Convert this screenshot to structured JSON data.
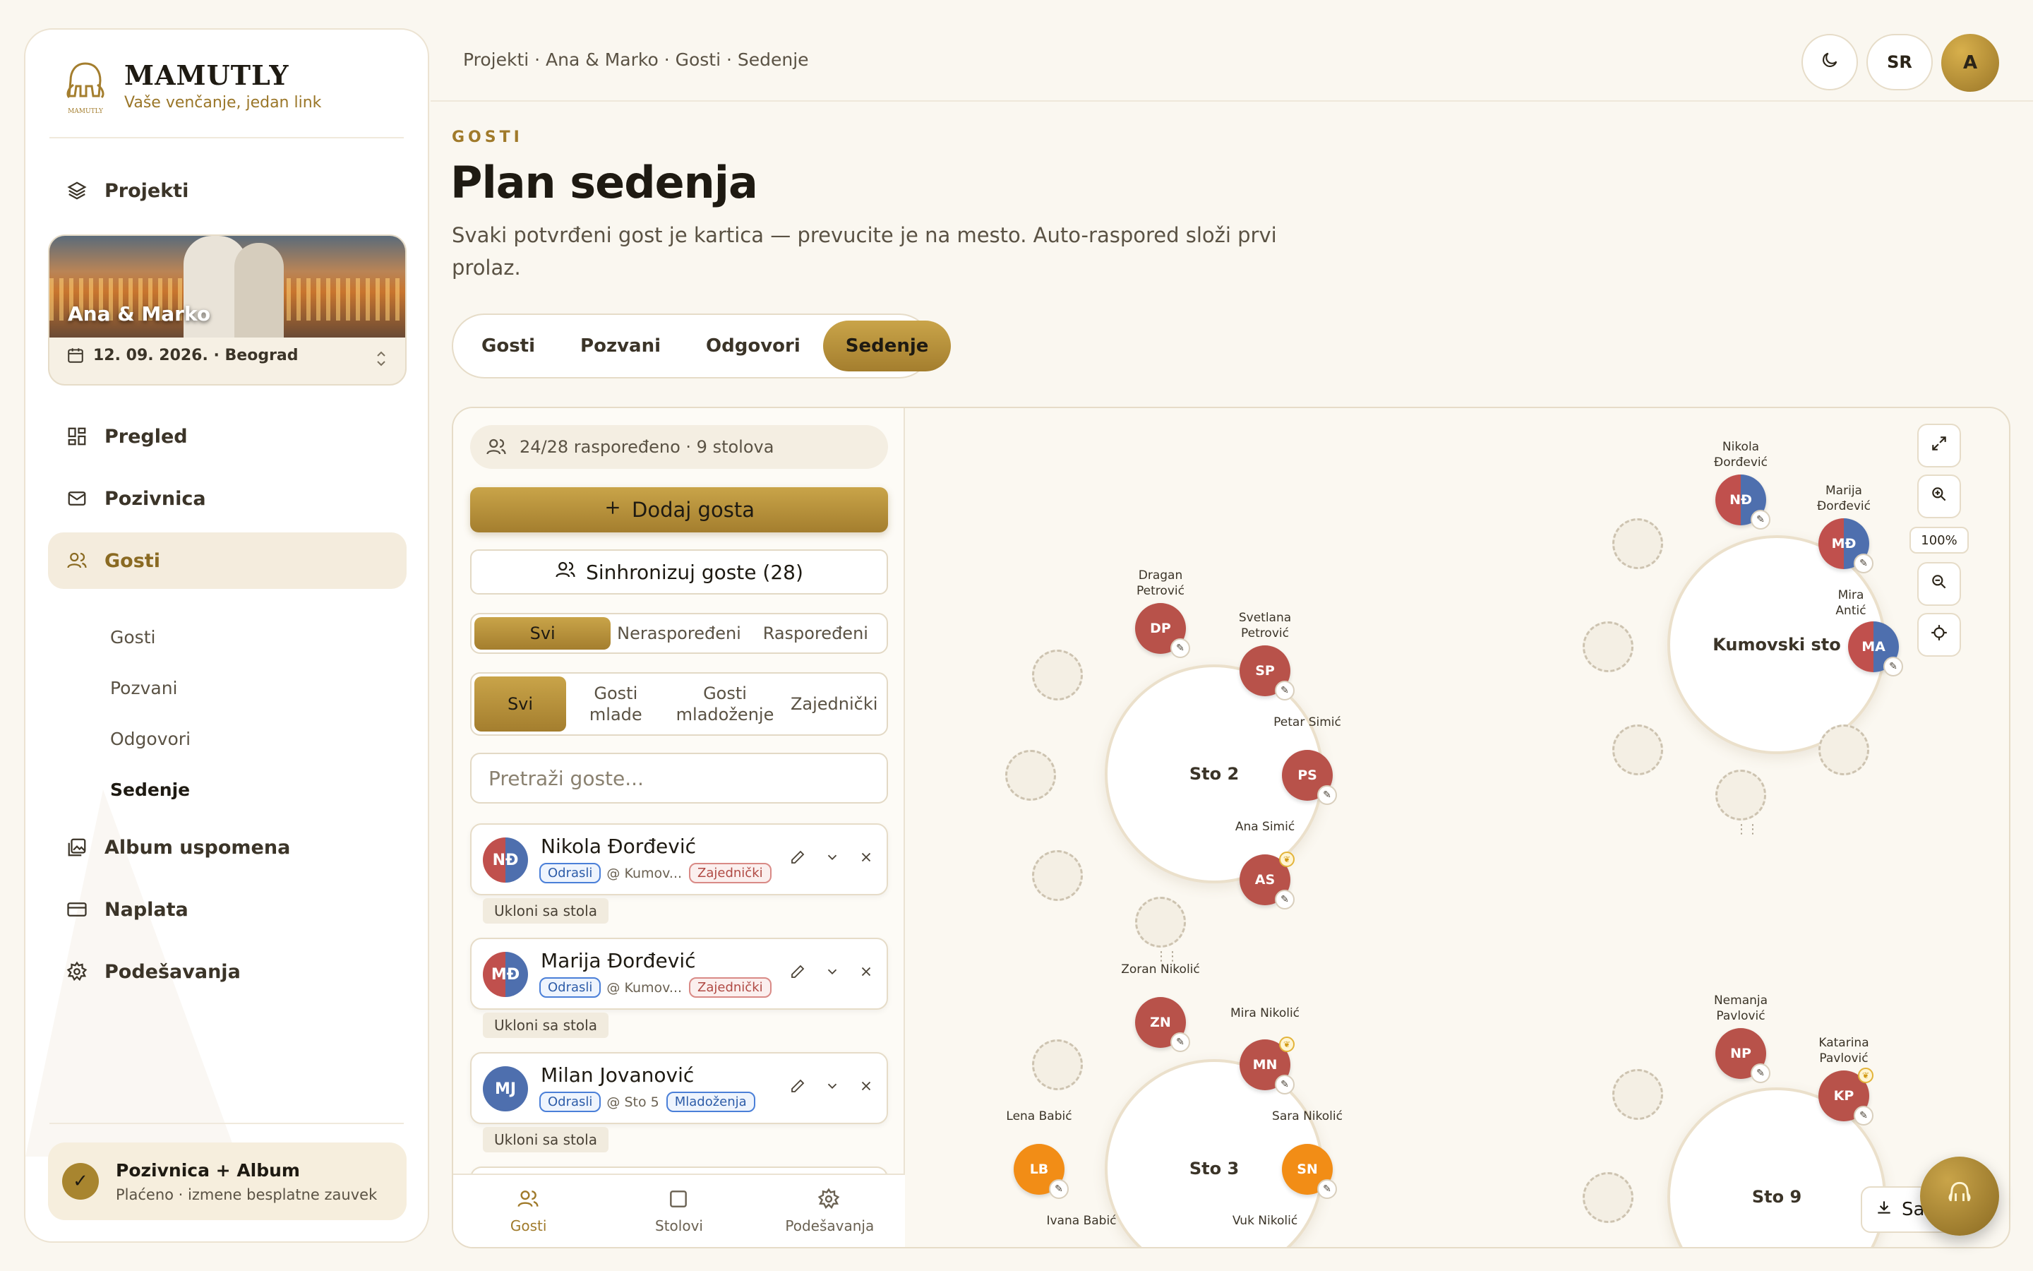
{
  "brand": {
    "name": "MAMUTLY",
    "tagline": "Vaše venčanje, jedan link",
    "logo_text": "MAMUTLY"
  },
  "sidebar": {
    "projects_label": "Projekti",
    "project": {
      "name": "Ana & Marko",
      "meta": "12. 09. 2026. · Beograd"
    },
    "nav": [
      {
        "label": "Pregled",
        "icon": "grid-icon"
      },
      {
        "label": "Pozivnica",
        "icon": "mail-icon"
      },
      {
        "label": "Gosti",
        "icon": "users-icon",
        "active": true
      },
      {
        "label": "Album uspomena",
        "icon": "gallery-icon"
      },
      {
        "label": "Naplata",
        "icon": "card-icon"
      },
      {
        "label": "Podešavanja",
        "icon": "gear-icon"
      }
    ],
    "sub_nav": [
      "Gosti",
      "Pozvani",
      "Odgovori",
      "Sedenje"
    ],
    "plan": {
      "title": "Pozivnica + Album",
      "subtitle": "Plaćeno · izmene besplatne zauvek"
    }
  },
  "topbar": {
    "breadcrumb": "Projekti · Ana & Marko · Gosti · Sedenje",
    "lang": "SR",
    "avatar": "A"
  },
  "header": {
    "eyebrow": "GOSTI",
    "title": "Plan sedenja",
    "description": "Svaki potvrđeni gost je kartica — prevucite je na mesto. Auto-raspored složi prvi prolaz."
  },
  "tabs": [
    "Gosti",
    "Pozvani",
    "Odgovori",
    "Sedenje"
  ],
  "panel": {
    "stats": "24/28 raspoređeno · 9 stolova",
    "add_label": "Dodaj gosta",
    "sync_label": "Sinhronizuj goste (28)",
    "filter_status": [
      "Svi",
      "Neraspoređeni",
      "Raspoređeni"
    ],
    "filter_side": [
      "Svi",
      "Gosti mlade",
      "Gosti mladoženje",
      "Zajednički"
    ],
    "search_placeholder": "Pretraži goste...",
    "remove_label": "Ukloni sa stola",
    "guests": [
      {
        "initials": "NĐ",
        "name": "Nikola Đorđević",
        "age": "Odrasli",
        "table": "@ Kumov...",
        "side": "Zajednički"
      },
      {
        "initials": "MĐ",
        "name": "Marija Đorđević",
        "age": "Odrasli",
        "table": "@ Kumov...",
        "side": "Zajednički"
      },
      {
        "initials": "MJ",
        "name": "Milan Jovanović",
        "age": "Odrasli",
        "table": "@ Sto 5",
        "side": "Mladoženja"
      }
    ],
    "bottom_nav": [
      "Gosti",
      "Stolovi",
      "Podešavanja"
    ]
  },
  "canvas": {
    "zoom": "100%",
    "export_label": "Sačuvaj",
    "tables": {
      "sto2": "Sto 2",
      "kumovski": "Kumovski sto",
      "sto3": "Sto 3",
      "sto9": "Sto 9"
    },
    "seats": {
      "dp": {
        "initials": "DP",
        "label": "Dragan Petrović"
      },
      "sp": {
        "initials": "SP",
        "label": "Svetlana Petrović"
      },
      "ps": {
        "initials": "PS",
        "label": "Petar Simić"
      },
      "as": {
        "initials": "AS",
        "label": "Ana Simić"
      },
      "nd": {
        "initials": "NĐ",
        "label": "Nikola Đorđević"
      },
      "md": {
        "initials": "MĐ",
        "label": "Marija Đorđević"
      },
      "ma": {
        "initials": "MA",
        "label": "Mira Antić"
      },
      "zn": {
        "initials": "ZN",
        "label": "Zoran Nikolić"
      },
      "mn": {
        "initials": "MN",
        "label": "Mira Nikolić"
      },
      "lb": {
        "initials": "LB",
        "label": "Lena Babić"
      },
      "sn": {
        "initials": "SN",
        "label": "Sara Nikolić"
      },
      "ib": {
        "label": "Ivana Babić"
      },
      "vn": {
        "label": "Vuk Nikolić"
      },
      "np": {
        "initials": "NP",
        "label": "Nemanja Pavlović"
      },
      "kp": {
        "initials": "KP",
        "label": "Katarina Pavlović"
      }
    }
  },
  "colors": {
    "accent": "#a47e2e",
    "seat_red": "#b8524a",
    "seat_orange": "#f28d16",
    "seat_blue": "#4e6fae"
  }
}
